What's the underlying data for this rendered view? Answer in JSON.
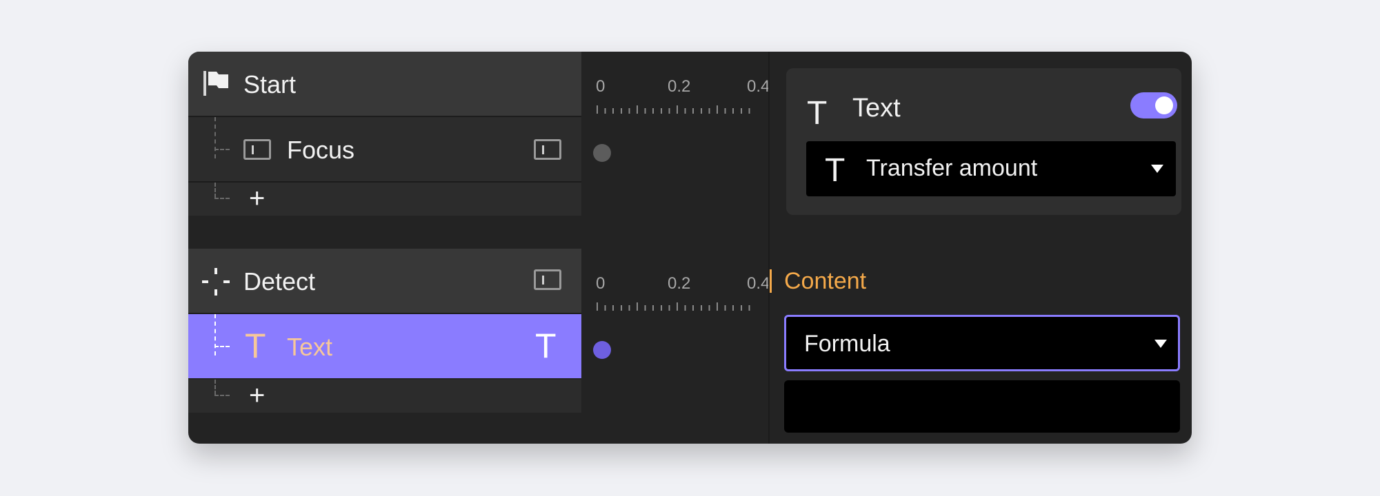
{
  "steps": [
    {
      "header": {
        "label": "Start",
        "icon": "flag-icon"
      },
      "children": [
        {
          "label": "Focus",
          "icon": "frame-icon",
          "action_icon": "frame-icon"
        }
      ],
      "add_label": "+",
      "timeline_ticks": [
        "0",
        "0.2",
        "0.4"
      ]
    },
    {
      "header": {
        "label": "Detect",
        "icon": "crosshair-icon",
        "action_icon": "frame-icon"
      },
      "children": [
        {
          "label": "Text",
          "icon": "text-icon",
          "action_icon": "text-icon",
          "selected": true
        }
      ],
      "add_label": "+",
      "timeline_ticks": [
        "0",
        "0.2",
        "0.4"
      ]
    }
  ],
  "inspector": {
    "card": {
      "title": "Text",
      "title_icon": "T",
      "toggle_on": true,
      "select_icon": "T",
      "select_value": "Transfer amount"
    },
    "content_label": "Content",
    "formula_select": "Formula",
    "formula_value": ""
  },
  "colors": {
    "accent": "#8a7cff",
    "content_label": "#f4a94a",
    "selected_text": "#f6c79a",
    "window_bg": "#232323"
  }
}
